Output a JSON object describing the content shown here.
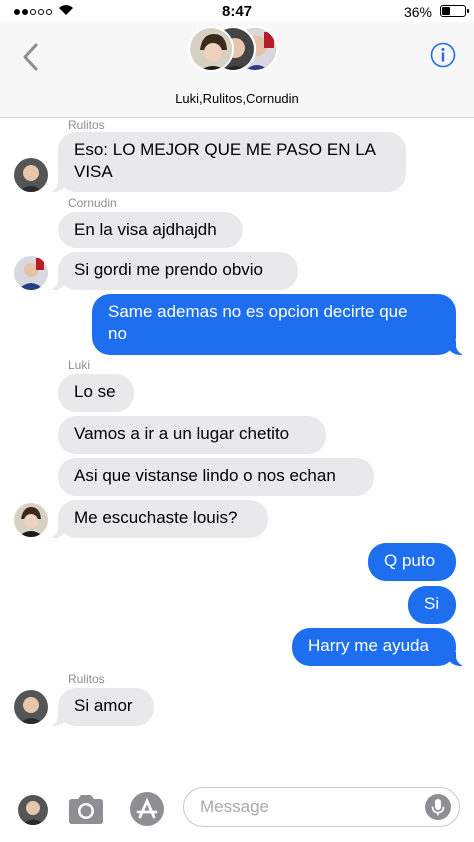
{
  "status_bar": {
    "time": "8:47",
    "battery_text": "36%",
    "battery_level": 0.36,
    "signal_bars_filled": 2,
    "signal_bars_total": 5
  },
  "header": {
    "group_name": "Luki,Rulitos,Cornudin",
    "back_icon": "chevron-left-icon",
    "info_icon": "info-icon"
  },
  "colors": {
    "incoming_bubble": "#e9e9eb",
    "outgoing_bubble": "#1e6ff0",
    "accent": "#1e6ff0"
  },
  "messages": [
    {
      "sender": "Rulitos",
      "text_lines": [
        "Eso: LO MEJOR QUE ME PASO EN LA",
        "VISA"
      ],
      "direction": "in"
    },
    {
      "sender": "Cornudin",
      "text_lines": [
        "En la visa ajdhajdh"
      ],
      "direction": "in"
    },
    {
      "text_lines": [
        "Si gordi me prendo obvio"
      ],
      "direction": "in"
    },
    {
      "text_lines": [
        "Same ademas no es opcion decirte que",
        "no"
      ],
      "direction": "out"
    },
    {
      "sender": "Luki",
      "text_lines": [
        "Lo se"
      ],
      "direction": "in"
    },
    {
      "text_lines": [
        "Vamos a ir a un lugar chetito"
      ],
      "direction": "in"
    },
    {
      "text_lines": [
        "Asi que vistanse lindo o nos echan"
      ],
      "direction": "in"
    },
    {
      "text_lines": [
        "Me escuchaste louis?"
      ],
      "direction": "in"
    },
    {
      "text_lines": [
        "Q puto"
      ],
      "direction": "out"
    },
    {
      "text_lines": [
        "Si"
      ],
      "direction": "out"
    },
    {
      "text_lines": [
        "Harry me ayuda"
      ],
      "direction": "out"
    },
    {
      "sender": "Rulitos",
      "text_lines": [
        "Si amor"
      ],
      "direction": "in"
    }
  ],
  "input_bar": {
    "placeholder": "Message",
    "camera_icon": "camera-icon",
    "appstore_icon": "app-store-icon",
    "mic_icon": "microphone-icon"
  }
}
